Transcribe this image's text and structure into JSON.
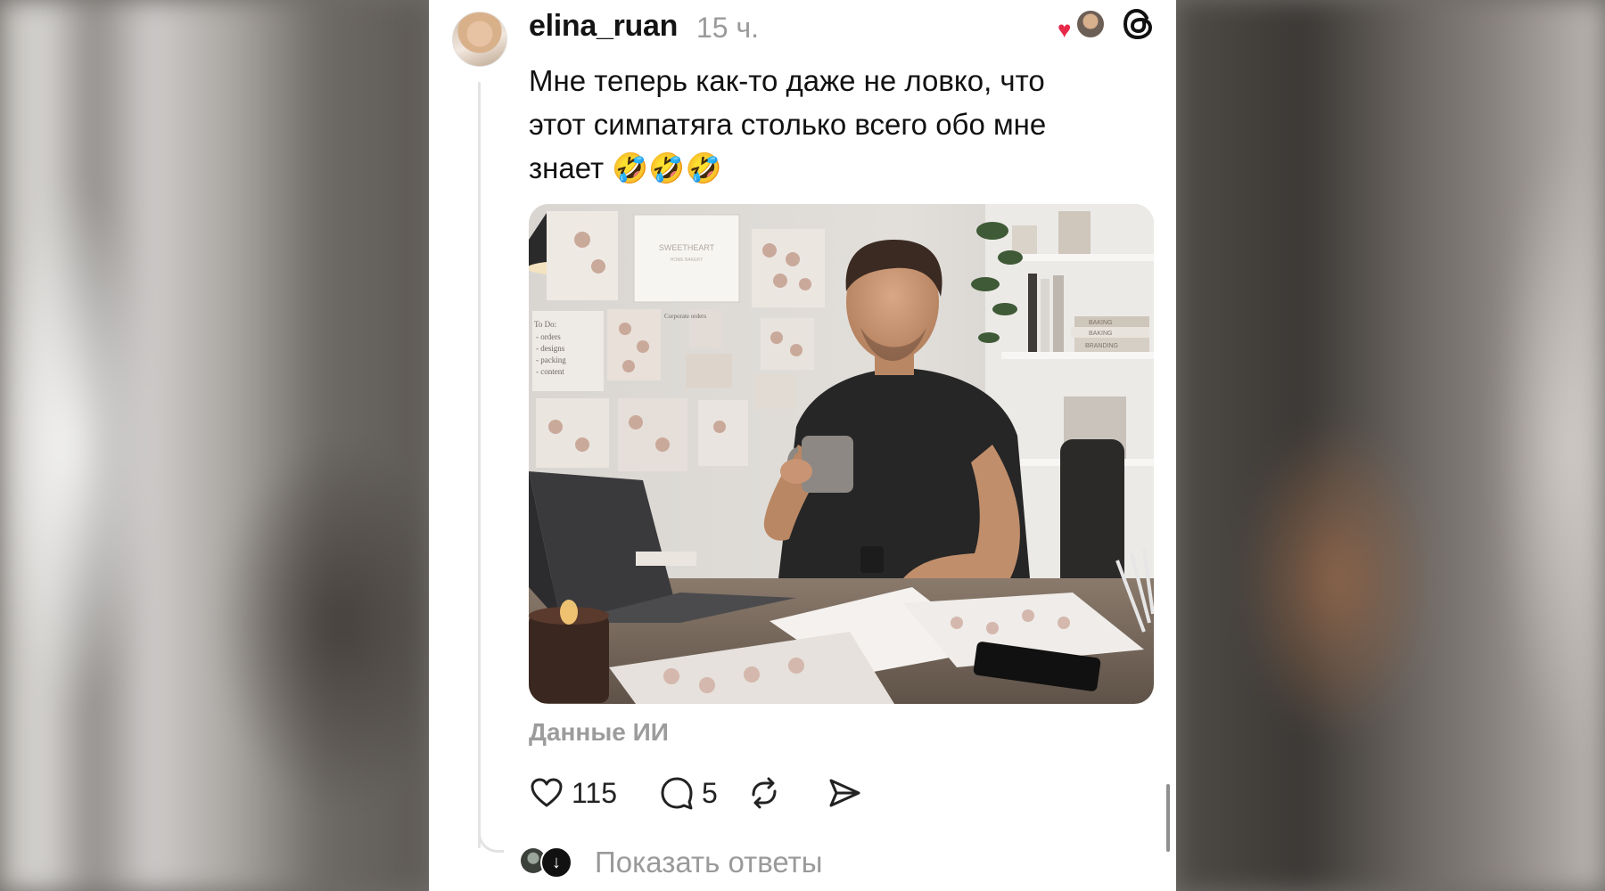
{
  "post": {
    "author": {
      "username": "elina_ruan",
      "time": "15 ч."
    },
    "text_line1": "Мне теперь как-то даже не ловко, что",
    "text_line2": "этот симпатяга столько всего обо мне",
    "text_line3": "знает",
    "emojis": "🤣🤣🤣",
    "ai_label": "Данные ИИ",
    "photo": {
      "board_title": "SWEETHEART",
      "board_subtitle": "HOME BAKERY",
      "todo_title": "To Do:",
      "todo_items": [
        "- orders",
        "- designs",
        "- packing",
        "- content"
      ],
      "note": "Corporate orders",
      "books": [
        "BAKING",
        "BAKING",
        "BRANDING"
      ]
    },
    "actions": {
      "likes": "115",
      "comments": "5"
    },
    "show_replies": "Показать ответы"
  },
  "colors": {
    "accent_heart": "#e8294a",
    "muted_text": "#9a9a9a",
    "thread_line": "#e3e3e3"
  },
  "icons": [
    "threads-logo-icon",
    "heart-icon",
    "comment-icon",
    "repost-icon",
    "share-icon",
    "arrow-down-icon"
  ]
}
